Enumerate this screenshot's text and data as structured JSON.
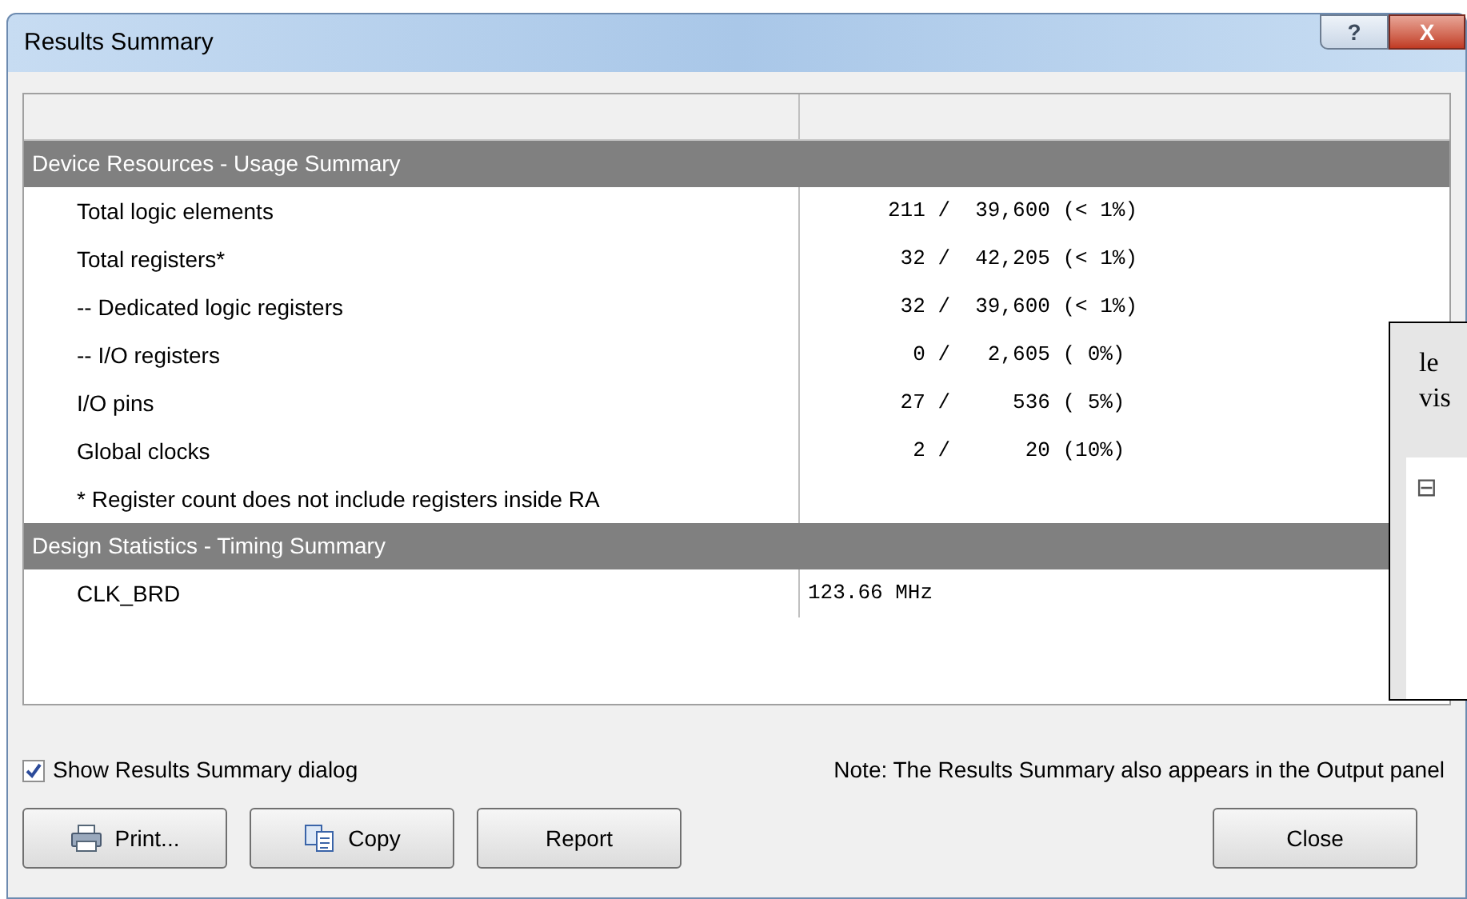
{
  "window": {
    "title": "Results Summary",
    "buttons": [
      {
        "kind": "help",
        "label": "?"
      },
      {
        "kind": "close",
        "label": "X"
      }
    ]
  },
  "table": {
    "sections": [
      {
        "title": "Device Resources - Usage Summary",
        "rows": [
          {
            "name": "Total logic elements",
            "value": "211 /  39,600 (< 1%)"
          },
          {
            "name": "Total registers*",
            "value": " 32 /  42,205 (< 1%)"
          },
          {
            "name": "-- Dedicated logic registers",
            "value": " 32 /  39,600 (< 1%)"
          },
          {
            "name": "-- I/O registers",
            "value": "  0 /   2,605 ( 0%)"
          },
          {
            "name": "I/O pins",
            "value": " 27 /     536 ( 5%)"
          },
          {
            "name": "Global clocks",
            "value": "  2 /      20 (10%)"
          },
          {
            "name": "*  Register count does not include registers inside RA"
          }
        ]
      },
      {
        "title": "Design Statistics - Timing Summary",
        "rows": [
          {
            "name": "CLK_BRD",
            "value": "123.66 MHz"
          }
        ]
      }
    ]
  },
  "show_dialog": {
    "label": "Show Results Summary dialog",
    "checked": true
  },
  "note": "Note: The Results Summary also appears in the Output panel",
  "buttons": [
    {
      "kind": "print",
      "label": "Print..."
    },
    {
      "kind": "copy",
      "label": "Copy"
    },
    {
      "kind": "plain",
      "label": "Report"
    }
  ],
  "close_button": "Close",
  "overlay": {
    "lines": [
      "le",
      "vis"
    ],
    "toggle": "⊟"
  }
}
